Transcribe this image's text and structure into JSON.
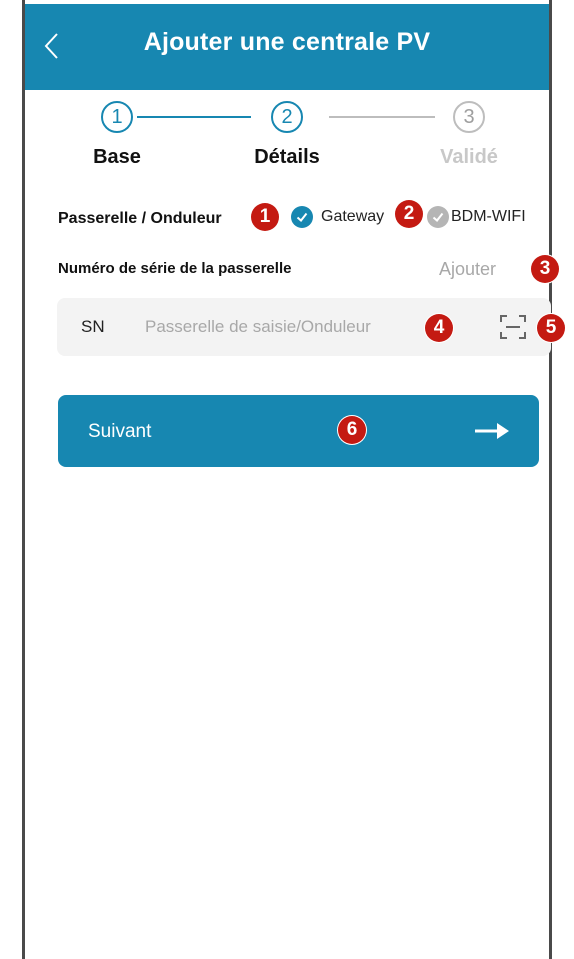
{
  "header": {
    "back_icon": "chevron-left-icon",
    "title": "Ajouter une centrale PV"
  },
  "stepper": {
    "steps": [
      {
        "number": "1",
        "label": "Base",
        "state": "done"
      },
      {
        "number": "2",
        "label": "Détails",
        "state": "current"
      },
      {
        "number": "3",
        "label": "Validé",
        "state": "pending"
      }
    ]
  },
  "device": {
    "label": "Passerelle / Onduleur",
    "options": [
      {
        "label": "Gateway",
        "selected": true
      },
      {
        "label": "BDM-WIFI",
        "selected": false
      }
    ]
  },
  "serial": {
    "label": "Numéro de série de la passerelle",
    "add_label": "Ajouter",
    "prefix": "SN",
    "value": "",
    "placeholder": "Passerelle de saisie/Onduleur",
    "scan_icon": "scan-icon"
  },
  "next_button": {
    "label": "Suivant",
    "icon": "arrow-right-icon"
  },
  "annotations": [
    "1",
    "2",
    "3",
    "4",
    "5",
    "6"
  ],
  "colors": {
    "accent": "#1787b1",
    "badge": "#c41a12",
    "inactive": "#bdbdbd"
  }
}
